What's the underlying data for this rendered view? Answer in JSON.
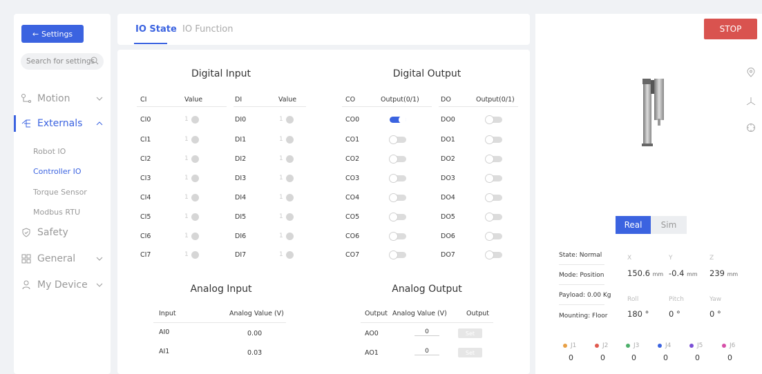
{
  "sidebar": {
    "settings_label": "Settings",
    "search_placeholder": "Search for settings",
    "nav": [
      {
        "label": "Motion",
        "icon": "motion-icon",
        "expanded": false
      },
      {
        "label": "Externals",
        "icon": "externals-icon",
        "expanded": true
      },
      {
        "label": "Safety",
        "icon": "shield-icon"
      },
      {
        "label": "General",
        "icon": "grid-icon",
        "expanded": false
      },
      {
        "label": "My Device",
        "icon": "user-icon",
        "expanded": false
      }
    ],
    "externals_sub": [
      "Robot IO",
      "Controller IO",
      "Torque Sensor",
      "Modbus RTU"
    ]
  },
  "tabs": [
    "IO State",
    "IO Function"
  ],
  "digital_input": {
    "title": "Digital Input",
    "headers": [
      "CI",
      "Value",
      "DI",
      "Value"
    ],
    "ci": [
      "CI0",
      "CI1",
      "CI2",
      "CI3",
      "CI4",
      "CI5",
      "CI6",
      "CI7"
    ],
    "di": [
      "DI0",
      "DI1",
      "DI2",
      "DI3",
      "DI4",
      "DI5",
      "DI6",
      "DI7"
    ],
    "value_text": "1"
  },
  "digital_output": {
    "title": "Digital Output",
    "headers": [
      "CO",
      "Output(0/1)",
      "DO",
      "Output(0/1)"
    ],
    "co": [
      "CO0",
      "CO1",
      "CO2",
      "CO3",
      "CO4",
      "CO5",
      "CO6",
      "CO7"
    ],
    "do": [
      "DO0",
      "DO1",
      "DO2",
      "DO3",
      "DO4",
      "DO5",
      "DO6",
      "DO7"
    ],
    "co_states": [
      1,
      0,
      0,
      0,
      0,
      0,
      0,
      0
    ],
    "do_states": [
      0,
      0,
      0,
      0,
      0,
      0,
      0,
      0
    ]
  },
  "analog_input": {
    "title": "Analog Input",
    "headers": [
      "Input",
      "Analog Value (V)"
    ],
    "rows": [
      {
        "name": "AI0",
        "value": "0.00"
      },
      {
        "name": "AI1",
        "value": "0.03"
      }
    ]
  },
  "analog_output": {
    "title": "Analog Output",
    "headers": [
      "Output",
      "Analog Value (V)",
      "Output"
    ],
    "rows": [
      {
        "name": "AO0",
        "value": "0"
      },
      {
        "name": "AO1",
        "value": "0"
      }
    ],
    "set_label": "Set"
  },
  "right": {
    "stop_label": "STOP",
    "mode_real": "Real",
    "mode_sim": "Sim",
    "info": [
      "State: Normal",
      "Mode: Position",
      "Payload: 0.00 Kg",
      "Mounting: Floor"
    ],
    "pos_axes": [
      "X",
      "Y",
      "Z"
    ],
    "pos_values": [
      "150.6",
      "-0.4",
      "239"
    ],
    "pos_unit": "mm",
    "rot_axes": [
      "Roll",
      "Pitch",
      "Yaw"
    ],
    "rot_values": [
      "180 °",
      "0 °",
      "0 °"
    ],
    "joints": [
      {
        "name": "J1",
        "value": "0",
        "color": "#e8a045"
      },
      {
        "name": "J2",
        "value": "0",
        "color": "#e05a4f"
      },
      {
        "name": "J3",
        "value": "0",
        "color": "#4caf6a"
      },
      {
        "name": "J4",
        "value": "0",
        "color": "#3b63e0"
      },
      {
        "name": "J5",
        "value": "0",
        "color": "#7a4fd6"
      },
      {
        "name": "J6",
        "value": "0",
        "color": "#d64fa8"
      }
    ]
  },
  "colors": {
    "accent": "#3b63e0",
    "stop": "#d9534f"
  }
}
